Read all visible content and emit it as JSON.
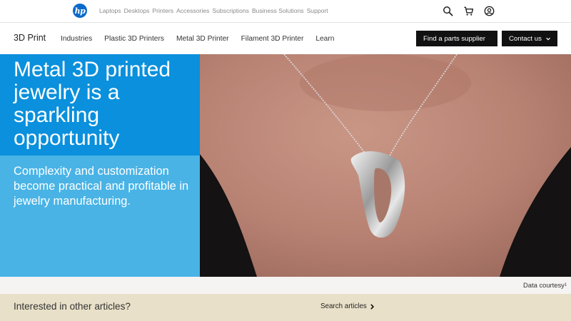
{
  "topbar": {
    "logo_text": "hp",
    "nav": [
      "Laptops",
      "Desktops",
      "Printers",
      "Accessories",
      "Subscriptions",
      "Business Solutions",
      "Support"
    ],
    "icons": [
      "search-icon",
      "cart-icon",
      "user-icon"
    ]
  },
  "subbar": {
    "brand": "3D Print",
    "nav": [
      "Industries",
      "Plastic 3D Printers",
      "Metal 3D Printer",
      "Filament 3D Printer",
      "Learn"
    ],
    "find_supplier_label": "Find a parts supplier",
    "contact_label": "Contact us"
  },
  "hero": {
    "title": "Metal 3D printed jewelry is a sparkling opportunity",
    "subtitle": "Complexity and customization become practical and profitable in jewelry manufacturing."
  },
  "courtesy": {
    "text": "Data courtesy¹"
  },
  "interest": {
    "text": "Interested in other articles?",
    "link_label": "Search articles"
  },
  "colors": {
    "hero_title_bg": "#0a90dc",
    "hero_sub_bg": "#49b3e6",
    "interest_bg": "#e9e0c9",
    "button_bg": "#111111"
  }
}
